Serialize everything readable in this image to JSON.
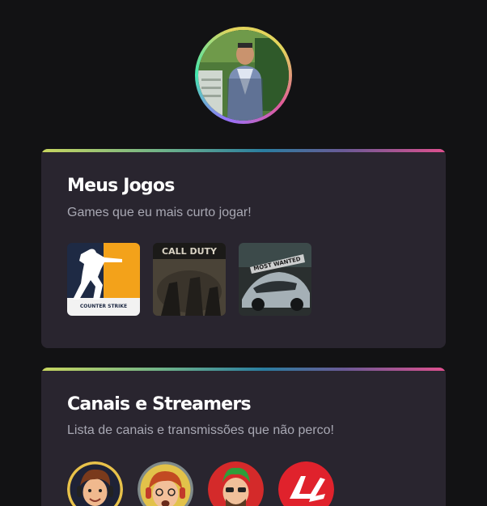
{
  "profile": {
    "avatar_icon": "profile-photo",
    "ring_colors": [
      "#e2d45c",
      "#43e7ad",
      "#9572fc",
      "#e05a9a"
    ]
  },
  "games_card": {
    "title": "Meus Jogos",
    "subtitle": "Games que eu mais curto jogar!",
    "items": [
      {
        "name": "Counter-Strike",
        "logo_text": "COUNTER STRIKE"
      },
      {
        "name": "Call of Duty",
        "logo_text": "CALL DUTY"
      },
      {
        "name": "Need for Speed Most Wanted",
        "logo_text": "MOST WANTED"
      }
    ]
  },
  "streamers_card": {
    "title": "Canais e Streamers",
    "subtitle": "Lista de canais e transmissões que não perco!",
    "items": [
      {
        "name": "streamer-1"
      },
      {
        "name": "streamer-2"
      },
      {
        "name": "streamer-3"
      },
      {
        "name": "streamer-4"
      }
    ]
  },
  "colors": {
    "background": "#121214",
    "card": "#29252f",
    "title": "#ffffff",
    "subtitle": "#a8a8b3"
  }
}
